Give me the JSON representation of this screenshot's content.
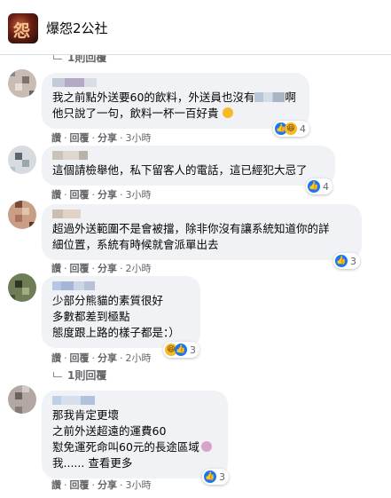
{
  "group": {
    "name": "爆怨2公社"
  },
  "reply_link_top": "1則回覆",
  "reply_link_bottom": "1則回覆",
  "comments": [
    {
      "lines": [
        "我之前點外送要60的飲料，外送員也沒有",
        "他只說了一句，飲料一杯一百好貴"
      ],
      "line1_suffix": "啊",
      "actions": {
        "like": "讚",
        "reply": "回覆",
        "share": "分享",
        "time": "3小時"
      },
      "reaction_count": "4"
    },
    {
      "lines": [
        "這個請檢舉他，私下留客人的電話，這已經犯大忌了"
      ],
      "actions": {
        "like": "讚",
        "reply": "回覆",
        "share": "分享",
        "time": "3小時"
      },
      "reaction_count": "4"
    },
    {
      "lines": [
        "超過外送範圍不是會被擋，除非你沒有讓系統知道你的詳",
        "細位置，系統有時候就會派單出去"
      ],
      "actions": {
        "like": "讚",
        "reply": "回覆",
        "share": "分享",
        "time": "2小時"
      },
      "reaction_count": "3"
    },
    {
      "lines": [
        "少部分熊貓的素質很好",
        "多數都差到極點",
        "態度跟上路的樣子都是：）"
      ],
      "actions": {
        "like": "讚",
        "reply": "回覆",
        "share": "分享",
        "time": "2小時"
      },
      "reaction_count": "3"
    },
    {
      "lines": [
        "那我肯定更壞",
        "之前外送超遠的運費60",
        "懟免運死命叫60元的長途區域",
        "我...... 查看更多"
      ],
      "actions": {
        "like": "讚",
        "reply": "回覆",
        "share": "分享",
        "time": "3小時"
      },
      "reaction_count": "3"
    }
  ],
  "colors": {
    "bubble": "#f0f2f5",
    "like": "#1877f2",
    "haha": "#f7b928",
    "meta": "#65676b"
  }
}
